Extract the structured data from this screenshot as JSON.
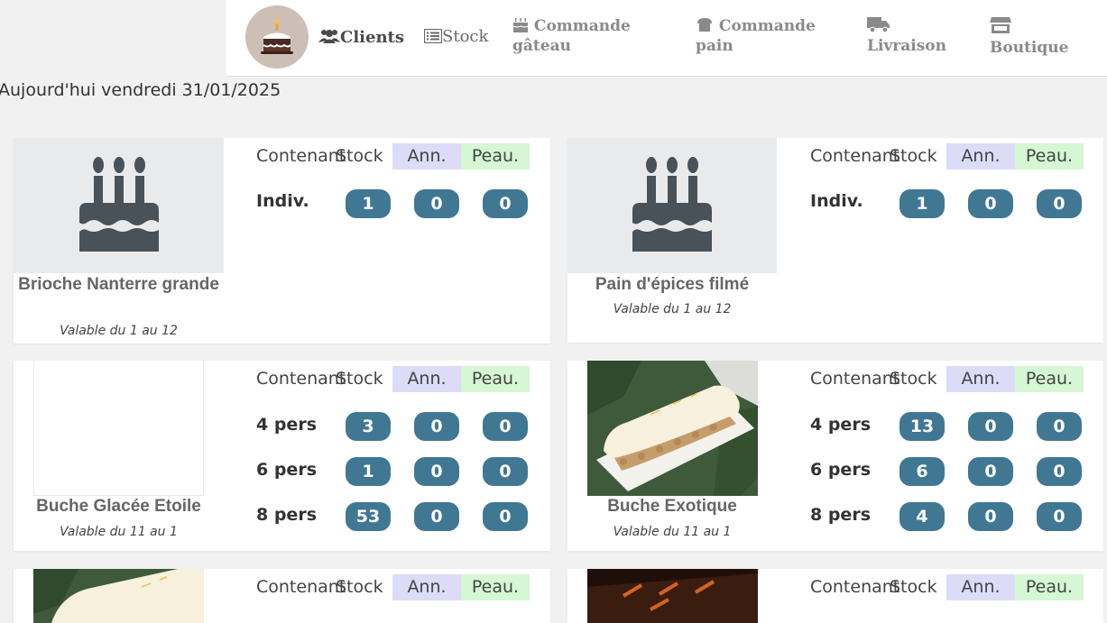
{
  "nav": {
    "clients": "Clients",
    "stock": "Stock",
    "commande_gateau_line1": "Commande",
    "commande_gateau_line2": "gâteau",
    "commande_pain_line1": "Commande",
    "commande_pain_line2": "pain",
    "livraison": "Livraison",
    "boutique": "Boutique"
  },
  "today": "Aujourd'hui vendredi 31/01/2025",
  "table_headers": {
    "contenant": "Contenant",
    "stock": "Stock",
    "ann": "Ann.",
    "peau": "Peau."
  },
  "products": [
    {
      "name": "Brioche Nanterre grande",
      "validity": "Valable du 1 au 12",
      "rows": [
        {
          "label": "Indiv.",
          "stock": "1",
          "ann": "0",
          "peau": "0"
        }
      ]
    },
    {
      "name": "Pain d'épices filmé",
      "validity": "Valable du 1 au 12",
      "rows": [
        {
          "label": "Indiv.",
          "stock": "1",
          "ann": "0",
          "peau": "0"
        }
      ]
    },
    {
      "name": "Buche Glacée Etoile",
      "validity": "Valable du 11 au 1",
      "rows": [
        {
          "label": "4 pers",
          "stock": "3",
          "ann": "0",
          "peau": "0"
        },
        {
          "label": "6 pers",
          "stock": "1",
          "ann": "0",
          "peau": "0"
        },
        {
          "label": "8 pers",
          "stock": "53",
          "ann": "0",
          "peau": "0"
        }
      ]
    },
    {
      "name": "Buche Exotique",
      "validity": "Valable du 11 au 1",
      "rows": [
        {
          "label": "4 pers",
          "stock": "13",
          "ann": "0",
          "peau": "0"
        },
        {
          "label": "6 pers",
          "stock": "6",
          "ann": "0",
          "peau": "0"
        },
        {
          "label": "8 pers",
          "stock": "4",
          "ann": "0",
          "peau": "0"
        }
      ]
    }
  ],
  "colors": {
    "pill": "#407894",
    "ann_header": "#dcdcf8",
    "peau_header": "#d5f7d3"
  }
}
